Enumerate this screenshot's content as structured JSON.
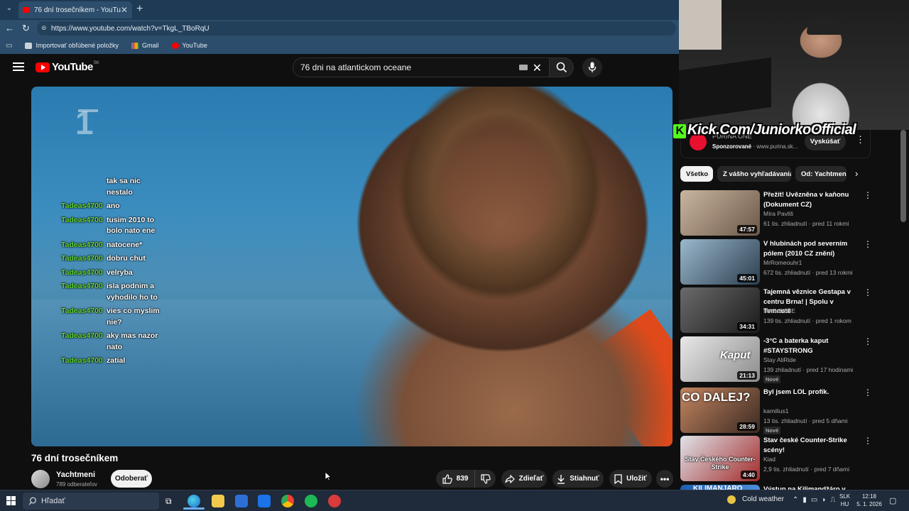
{
  "browser": {
    "tab_title": "76 dní trosečníkem - YouTube",
    "url": "https://www.youtube.com/watch?v=TkgL_TBoRqU",
    "bookmarks": [
      "Importovať obľúbené položky",
      "Gmail",
      "YouTube"
    ]
  },
  "youtube": {
    "logo_text": "YouTube",
    "region": "SK",
    "search_query": "76 dni na atlantickom oceane"
  },
  "chat": [
    {
      "user": "",
      "msg": "tak sa nic"
    },
    {
      "user": "",
      "msg": "nestalo"
    },
    {
      "user": "Tadeas4700",
      "msg": "ano"
    },
    {
      "user": "Tadeas4700",
      "msg": "tusim 2010 to"
    },
    {
      "user": "",
      "msg": "bolo nato ene"
    },
    {
      "user": "Tadeas4700",
      "msg": "natocene*"
    },
    {
      "user": "Tadeas4700",
      "msg": "dobru chut"
    },
    {
      "user": "Tadeas4700",
      "msg": "velryba"
    },
    {
      "user": "Tadeas4700",
      "msg": "isla podnim a"
    },
    {
      "user": "",
      "msg": "vyhodilo ho to"
    },
    {
      "user": "Tadeas4700",
      "msg": "vies co myslim"
    },
    {
      "user": "",
      "msg": "nie?"
    },
    {
      "user": "Tadeas4700",
      "msg": "aky mas nazor"
    },
    {
      "user": "",
      "msg": "nato"
    },
    {
      "user": "Tadeas4700",
      "msg": "zatial"
    }
  ],
  "video": {
    "title": "76 dní trosečníkem",
    "channel": "Yachtmeni",
    "subscribers": "789 odberateľov",
    "subscribe_label": "Odoberať",
    "likes": "839",
    "share_label": "Zdieľať",
    "download_label": "Stiahnuť",
    "save_label": "Uložiť"
  },
  "stream_overlay": {
    "kick_text": "Kick.Com/JuniorkoOfficial"
  },
  "ad": {
    "brand": "PURINA ONE",
    "sponsored": "Sponzorované",
    "domain": "www.purina.sk...",
    "cta": "Vyskúšať"
  },
  "chips": [
    "Všetko",
    "Z vášho vyhľadávania",
    "Od: Yachtmeni"
  ],
  "recommendations": [
    {
      "title": "Přežít! Uvězněna v kaňonu (Dokument CZ)",
      "channel": "Míra Pavliš",
      "meta": "61 tis. zhliadnutí · pred 11 rokmi",
      "duration": "47:57",
      "badge": ""
    },
    {
      "title": "V hlubinách pod severním pólem  (2010 CZ znění)",
      "channel": "MrRomeouhr1",
      "meta": "672 tis. zhliadnutí · pred 13 rokmi",
      "duration": "45:01",
      "badge": ""
    },
    {
      "title": "Tajemná věznice Gestapa v centru Brna! | Spolu v Temnotě",
      "channel": "MAD ZONE",
      "meta": "139 tis. zhliadnutí · pred 1 rokom",
      "duration": "34:31",
      "badge": ""
    },
    {
      "title": "-3°C a baterka kaput #STAYSTRONG",
      "channel": "Stay AliRide",
      "meta": "139 zhliadnutí · pred 17 hodinami",
      "duration": "21:13",
      "badge": "Nové"
    },
    {
      "title": "Byl jsem LOL profík.",
      "channel": "kamilius1",
      "meta": "13 tis. zhliadnutí · pred 5 dňami",
      "duration": "28:59",
      "badge": "Nové"
    },
    {
      "title": "Stav české Counter-Strike scény!",
      "channel": "Kiad",
      "meta": "2,9 tis. zhliadnutí · pred 7 dňami",
      "duration": "4:40",
      "badge": ""
    },
    {
      "title": "Výstup na Kilimandžáro v",
      "channel": "",
      "meta": "",
      "duration": "",
      "badge": ""
    }
  ],
  "thumb_texts": {
    "r4": "Kaput",
    "r5": "CO DALEJ?",
    "r6": "Stav Českého Counter-Strike",
    "r7": "KILIMANJARO"
  },
  "taskbar": {
    "search_placeholder": "Hľadať",
    "weather": "Cold weather",
    "lang_top": "SLK",
    "lang_bottom": "HU",
    "time": "12:18",
    "date": "5. 1. 2026"
  },
  "colors": {
    "youtube_red": "#ff0000",
    "chat_user": "#5fd636",
    "kick_green": "#53fc18",
    "tab_bg": "#1e3a54"
  }
}
